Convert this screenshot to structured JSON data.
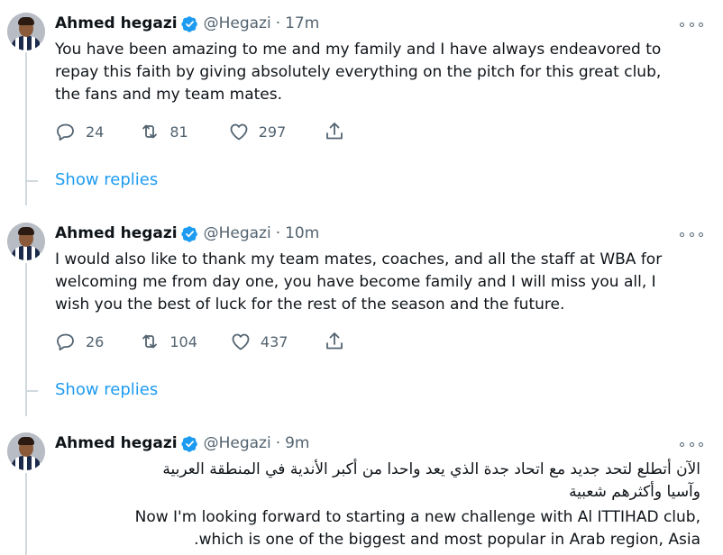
{
  "tweets": [
    {
      "name": "Ahmed hegazi",
      "handle": "@Hegazi",
      "dot": "·",
      "time": "17m",
      "lines": [
        "You have been amazing to me and my family and I have always endeavored to",
        "repay this faith by giving absolutely everything on the pitch for this great club,",
        "the fans and my team mates."
      ],
      "replies": "24",
      "retweets": "81",
      "likes": "297",
      "show_replies": "Show replies"
    },
    {
      "name": "Ahmed hegazi",
      "handle": "@Hegazi",
      "dot": "·",
      "time": "10m",
      "lines": [
        "I would also like to thank my team mates, coaches, and all the staff at WBA for",
        "welcoming me from day one, you have become family and I will miss you all, I",
        "wish you the best of luck for the rest of the season and the future."
      ],
      "replies": "26",
      "retweets": "104",
      "likes": "437",
      "show_replies": "Show replies"
    },
    {
      "name": "Ahmed hegazi",
      "handle": "@Hegazi",
      "dot": "·",
      "time": "9m",
      "arabic_lines": [
        "الآن أتطلع لتحد جديد مع اتحاد جدة الذي يعد واحدا من أكبر الأندية في المنطقة العربية",
        "وآسيا وأكثرهم شعبية"
      ],
      "english_lines": [
        "Now I'm looking forward to starting a new challenge with Al ITTIHAD club,",
        ".which is one of the biggest and most popular in Arab region, Asia"
      ]
    }
  ],
  "icons": {
    "verified_color": "#1d9bf0",
    "action_color": "#536471"
  }
}
